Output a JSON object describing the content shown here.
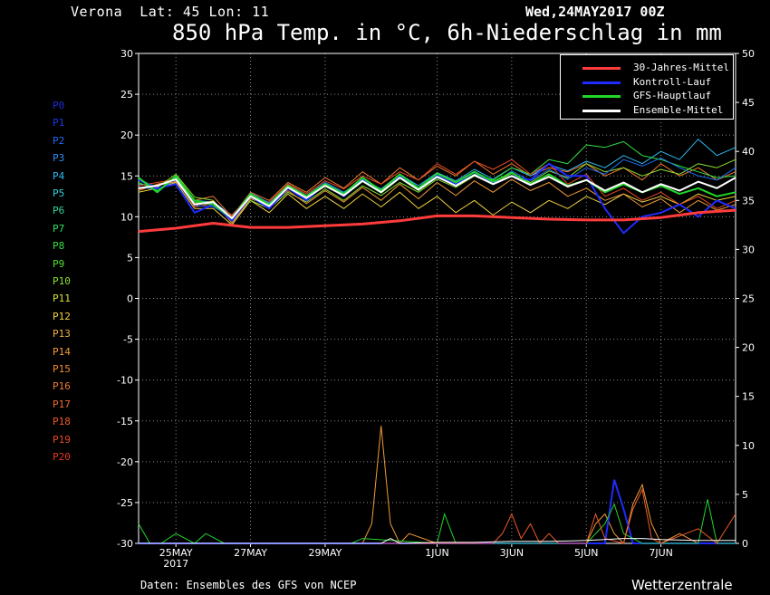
{
  "header": {
    "location": "Verona",
    "coords": "Lat: 45 Lon: 11",
    "run": "Wed,24MAY2017 00Z",
    "title": "850 hPa Temp. in °C, 6h-Niederschlag in mm"
  },
  "footer": {
    "source": "Daten: Ensembles des GFS von NCEP",
    "brand": "Wetterzentrale"
  },
  "members": [
    {
      "label": "P0",
      "color": "#1c2bd6"
    },
    {
      "label": "P1",
      "color": "#1c3ae8"
    },
    {
      "label": "P2",
      "color": "#1f6cf0"
    },
    {
      "label": "P3",
      "color": "#2a90f0"
    },
    {
      "label": "P4",
      "color": "#2fb8f0"
    },
    {
      "label": "P5",
      "color": "#2fd0d8"
    },
    {
      "label": "P6",
      "color": "#2fd8a0"
    },
    {
      "label": "P7",
      "color": "#2fe060"
    },
    {
      "label": "P8",
      "color": "#30e040"
    },
    {
      "label": "P9",
      "color": "#50e030"
    },
    {
      "label": "P10",
      "color": "#8ae030"
    },
    {
      "label": "P11",
      "color": "#d8e030"
    },
    {
      "label": "P12",
      "color": "#f0d040"
    },
    {
      "label": "P13",
      "color": "#f0b040"
    },
    {
      "label": "P14",
      "color": "#f09a38"
    },
    {
      "label": "P15",
      "color": "#f08a30"
    },
    {
      "label": "P16",
      "color": "#f07a30"
    },
    {
      "label": "P17",
      "color": "#f06a30"
    },
    {
      "label": "P18",
      "color": "#f05a2a"
    },
    {
      "label": "P19",
      "color": "#e84a24"
    },
    {
      "label": "P20",
      "color": "#e03a20"
    }
  ],
  "legend": [
    {
      "label": "30-Jahres-Mittel",
      "color": "#ff3b3b"
    },
    {
      "label": "Kontroll-Lauf",
      "color": "#1f2bff"
    },
    {
      "label": "GFS-Hauptlauf",
      "color": "#22d62a"
    },
    {
      "label": "Ensemble-Mittel",
      "color": "#ffffff"
    }
  ],
  "chart_data": {
    "type": "line",
    "x_unit": "days since 24MAY2017 00Z",
    "x_range": [
      0,
      16
    ],
    "x_ticks": [
      {
        "x": 1,
        "label": "25MAY",
        "sublabel": "2017"
      },
      {
        "x": 3,
        "label": "27MAY"
      },
      {
        "x": 5,
        "label": "29MAY"
      },
      {
        "x": 8,
        "label": "1JUN"
      },
      {
        "x": 10,
        "label": "3JUN"
      },
      {
        "x": 12,
        "label": "5JUN"
      },
      {
        "x": 14,
        "label": "7JUN"
      }
    ],
    "y_left": {
      "range": [
        -30,
        30
      ],
      "ticks": [
        -30,
        -25,
        -20,
        -15,
        -10,
        -5,
        0,
        5,
        10,
        15,
        20,
        25,
        30
      ],
      "label": "850 hPa Temp. °C"
    },
    "y_right": {
      "range": [
        0,
        50
      ],
      "ticks": [
        0,
        5,
        10,
        15,
        20,
        25,
        30,
        35,
        40,
        45,
        50
      ],
      "label": "6h-Niederschlag mm"
    },
    "grid": true,
    "series": [
      {
        "name": "30-Jahres-Mittel",
        "axis": "left",
        "width": 3,
        "x": [
          0,
          1,
          2,
          3,
          4,
          5,
          6,
          7,
          8,
          9,
          10,
          11,
          12,
          13,
          14,
          15,
          16
        ],
        "y": [
          8.2,
          8.6,
          9.2,
          8.7,
          8.7,
          8.9,
          9.1,
          9.5,
          10.1,
          10.1,
          9.9,
          9.7,
          9.6,
          9.6,
          9.9,
          10.5,
          10.8
        ]
      },
      {
        "name": "Kontroll-Lauf",
        "axis": "left",
        "width": 2,
        "x": [
          0,
          0.5,
          1,
          1.5,
          2,
          2.5,
          3,
          3.5,
          4,
          4.5,
          5,
          5.5,
          6,
          6.5,
          7,
          7.5,
          8,
          8.5,
          9,
          9.5,
          10,
          10.5,
          11,
          11.5,
          12,
          12.5,
          13,
          13.5,
          14,
          14.5,
          15,
          15.5,
          16
        ],
        "y": [
          14.5,
          13.5,
          14.0,
          10.5,
          11.5,
          9.5,
          12.5,
          11.0,
          13.5,
          12.0,
          14.0,
          12.5,
          14.5,
          13.0,
          15.0,
          13.5,
          15.0,
          14.0,
          15.5,
          14.0,
          15.0,
          14.5,
          16.5,
          15.0,
          15.0,
          11.0,
          8.0,
          10.0,
          10.5,
          11.5,
          10.0,
          12.0,
          11.0
        ]
      },
      {
        "name": "GFS-Hauptlauf",
        "axis": "left",
        "width": 2,
        "x": [
          0,
          0.5,
          1,
          1.5,
          2,
          2.5,
          3,
          3.5,
          4,
          4.5,
          5,
          5.5,
          6,
          6.5,
          7,
          7.5,
          8,
          8.5,
          9,
          9.5,
          10,
          10.5,
          11,
          11.5,
          12,
          12.5,
          13,
          13.5,
          14,
          14.5,
          15,
          15.5,
          16
        ],
        "y": [
          14.8,
          13.0,
          15.0,
          12.0,
          11.5,
          9.8,
          12.8,
          11.5,
          13.8,
          12.5,
          14.0,
          12.8,
          14.8,
          13.2,
          15.2,
          13.5,
          15.3,
          14.2,
          15.5,
          14.3,
          15.4,
          14.0,
          15.2,
          13.8,
          14.5,
          13.0,
          14.0,
          13.0,
          13.8,
          12.8,
          13.5,
          12.5,
          13.0
        ]
      },
      {
        "name": "Ensemble-Mittel",
        "axis": "left",
        "width": 2,
        "x": [
          0,
          0.5,
          1,
          1.5,
          2,
          2.5,
          3,
          3.5,
          4,
          4.5,
          5,
          5.5,
          6,
          6.5,
          7,
          7.5,
          8,
          8.5,
          9,
          9.5,
          10,
          10.5,
          11,
          11.5,
          12,
          12.5,
          13,
          13.5,
          14,
          14.5,
          15,
          15.5,
          16
        ],
        "y": [
          13.5,
          13.8,
          14.6,
          11.5,
          11.8,
          9.8,
          12.5,
          11.3,
          13.6,
          12.3,
          13.8,
          12.6,
          14.4,
          13.0,
          14.8,
          13.3,
          14.9,
          13.8,
          15.1,
          14.0,
          15.0,
          13.9,
          14.9,
          13.7,
          14.5,
          13.2,
          14.2,
          13.0,
          14.0,
          13.2,
          14.3,
          13.5,
          14.8
        ]
      },
      {
        "name": "P16",
        "axis": "left",
        "width": 1,
        "x": [
          0,
          0.5,
          1,
          1.5,
          2,
          2.5,
          3,
          3.5,
          4,
          4.5,
          5,
          5.5,
          6,
          6.5,
          7,
          7.5,
          8,
          8.5,
          9,
          9.5,
          10,
          10.5,
          11,
          11.5,
          12,
          12.5,
          13,
          13.5,
          14,
          14.5,
          15,
          15.5,
          16
        ],
        "y": [
          13.2,
          14.0,
          14.5,
          12.0,
          12.5,
          10.0,
          13.0,
          12.0,
          14.2,
          13.0,
          14.8,
          13.5,
          15.5,
          14.0,
          16.0,
          14.5,
          16.2,
          15.0,
          16.8,
          15.2,
          16.5,
          15.0,
          16.0,
          15.5,
          16.5,
          15.0,
          16.0,
          14.5,
          16.5,
          15.0,
          16.0,
          14.5,
          15.5
        ]
      },
      {
        "name": "P12",
        "axis": "left",
        "width": 1,
        "x": [
          0,
          0.5,
          1,
          1.5,
          2,
          2.5,
          3,
          3.5,
          4,
          4.5,
          5,
          5.5,
          6,
          6.5,
          7,
          7.5,
          8,
          8.5,
          9,
          9.5,
          10,
          10.5,
          11,
          11.5,
          12,
          12.5,
          13,
          13.5,
          14,
          14.5,
          15,
          15.5,
          16
        ],
        "y": [
          13.0,
          13.5,
          14.2,
          11.0,
          11.0,
          9.0,
          12.0,
          10.5,
          12.8,
          11.0,
          12.5,
          11.0,
          12.8,
          11.2,
          13.0,
          11.0,
          12.5,
          10.5,
          12.0,
          10.2,
          11.8,
          10.5,
          12.0,
          11.0,
          12.5,
          11.5,
          12.8,
          11.8,
          12.5,
          11.5,
          12.8,
          12.0,
          12.5
        ]
      },
      {
        "name": "P4",
        "axis": "left",
        "width": 1,
        "x": [
          0,
          0.5,
          1,
          1.5,
          2,
          2.5,
          3,
          3.5,
          4,
          4.5,
          5,
          5.5,
          6,
          6.5,
          7,
          7.5,
          8,
          8.5,
          9,
          9.5,
          10,
          10.5,
          11,
          11.5,
          12,
          12.5,
          13,
          13.5,
          14,
          14.5,
          15,
          15.5,
          16
        ],
        "y": [
          14.0,
          13.8,
          14.8,
          12.0,
          11.8,
          10.2,
          12.6,
          11.6,
          13.9,
          12.6,
          14.2,
          13.0,
          14.6,
          13.4,
          15.2,
          13.8,
          15.4,
          14.4,
          15.8,
          14.6,
          16.0,
          15.0,
          16.4,
          15.6,
          16.8,
          16.0,
          17.5,
          16.5,
          18.0,
          17.0,
          19.5,
          17.5,
          18.5
        ]
      },
      {
        "name": "P8",
        "axis": "left",
        "width": 1,
        "x": [
          0,
          0.5,
          1,
          1.5,
          2,
          2.5,
          3,
          3.5,
          4,
          4.5,
          5,
          5.5,
          6,
          6.5,
          7,
          7.5,
          8,
          8.5,
          9,
          9.5,
          10,
          10.5,
          11,
          11.5,
          12,
          12.5,
          13,
          13.5,
          14,
          14.5,
          15,
          15.5,
          16
        ],
        "y": [
          14.2,
          13.2,
          14.9,
          11.8,
          11.4,
          9.6,
          12.4,
          11.2,
          13.5,
          12.2,
          13.9,
          12.5,
          14.3,
          12.9,
          14.7,
          13.2,
          14.8,
          13.9,
          15.2,
          14.5,
          16.0,
          15.2,
          17.0,
          16.5,
          18.8,
          18.5,
          19.2,
          17.5,
          17.0,
          16.2,
          15.5,
          14.8,
          15.0
        ]
      },
      {
        "name": "P19",
        "axis": "left",
        "width": 1,
        "x": [
          0,
          0.5,
          1,
          1.5,
          2,
          2.5,
          3,
          3.5,
          4,
          4.5,
          5,
          5.5,
          6,
          6.5,
          7,
          7.5,
          8,
          8.5,
          9,
          9.5,
          10,
          10.5,
          11,
          11.5,
          12,
          12.5,
          13,
          13.5,
          14,
          14.5,
          15,
          15.5,
          16
        ],
        "y": [
          13.8,
          14.2,
          14.6,
          11.2,
          11.6,
          10.2,
          12.6,
          11.8,
          14.0,
          12.8,
          14.4,
          13.4,
          15.0,
          14.0,
          15.5,
          14.5,
          16.5,
          15.2,
          16.8,
          15.8,
          17.0,
          15.2,
          16.5,
          14.0,
          15.2,
          12.5,
          13.5,
          12.0,
          13.0,
          11.5,
          12.5,
          11.0,
          12.0
        ]
      },
      {
        "name": "P10",
        "axis": "left",
        "width": 1,
        "x": [
          0,
          0.5,
          1,
          1.5,
          2,
          2.5,
          3,
          3.5,
          4,
          4.5,
          5,
          5.5,
          6,
          6.5,
          7,
          7.5,
          8,
          8.5,
          9,
          9.5,
          10,
          10.5,
          11,
          11.5,
          12,
          12.5,
          13,
          13.5,
          14,
          14.5,
          15,
          15.5,
          16
        ],
        "y": [
          14.6,
          13.6,
          15.2,
          12.4,
          12.0,
          9.4,
          12.0,
          11.0,
          13.0,
          11.8,
          13.4,
          12.0,
          13.8,
          12.6,
          14.2,
          13.0,
          14.6,
          13.6,
          15.0,
          14.0,
          15.3,
          14.2,
          15.6,
          14.8,
          16.5,
          15.5,
          16.0,
          15.0,
          15.8,
          15.2,
          16.5,
          16.0,
          17.0
        ]
      },
      {
        "name": "P2",
        "axis": "left",
        "width": 1,
        "x": [
          0,
          0.5,
          1,
          1.5,
          2,
          2.5,
          3,
          3.5,
          4,
          4.5,
          5,
          5.5,
          6,
          6.5,
          7,
          7.5,
          8,
          8.5,
          9,
          9.5,
          10,
          10.5,
          11,
          11.5,
          12,
          12.5,
          13,
          13.5,
          14,
          14.5,
          15,
          15.5,
          16
        ],
        "y": [
          13.6,
          13.4,
          14.4,
          11.4,
          11.2,
          9.9,
          12.9,
          11.7,
          13.8,
          12.4,
          14.2,
          12.9,
          14.6,
          13.1,
          15.0,
          13.4,
          15.1,
          14.0,
          15.4,
          14.1,
          15.6,
          14.4,
          15.8,
          14.6,
          16.0,
          15.2,
          17.0,
          16.2,
          17.2,
          16.0,
          15.0,
          14.5,
          16.0
        ]
      },
      {
        "name": "P14",
        "axis": "left",
        "width": 1,
        "x": [
          0,
          0.5,
          1,
          1.5,
          2,
          2.5,
          3,
          3.5,
          4,
          4.5,
          5,
          5.5,
          6,
          6.5,
          7,
          7.5,
          8,
          8.5,
          9,
          9.5,
          10,
          10.5,
          11,
          11.5,
          12,
          12.5,
          13,
          13.5,
          14,
          14.5,
          15,
          15.5,
          16
        ],
        "y": [
          13.4,
          13.9,
          14.3,
          11.6,
          11.9,
          9.2,
          12.2,
          11.4,
          13.2,
          11.6,
          13.2,
          11.8,
          13.6,
          12.0,
          14.0,
          12.2,
          14.2,
          12.6,
          14.4,
          13.0,
          14.6,
          13.2,
          14.2,
          12.5,
          13.5,
          12.0,
          12.8,
          11.2,
          12.2,
          10.5,
          12.0,
          10.8,
          11.5
        ]
      }
    ],
    "precip_series": [
      {
        "name": "P14",
        "axis": "right",
        "x": [
          0,
          6,
          6.25,
          6.5,
          6.75,
          7,
          7.25,
          8,
          12,
          12.25,
          12.5,
          12.75,
          13,
          13.25,
          13.5,
          13.75,
          14,
          14.5,
          15,
          16
        ],
        "y": [
          0,
          0,
          2,
          12,
          2,
          0,
          1,
          0,
          0,
          2,
          3,
          1,
          0,
          4,
          6,
          2,
          0,
          1,
          0,
          0
        ]
      },
      {
        "name": "Kontroll-Lauf",
        "axis": "right",
        "x": [
          0,
          12.5,
          12.75,
          13,
          13.25,
          13.5,
          16
        ],
        "y": [
          0,
          0,
          6.5,
          3.5,
          0,
          0,
          0
        ]
      },
      {
        "name": "GFS-Hauptlauf",
        "axis": "right",
        "x": [
          0,
          0.3,
          0.6,
          1,
          1.5,
          1.8,
          2.3,
          5.7,
          6,
          8,
          8.2,
          8.5,
          11,
          12,
          12.5,
          12.75,
          13,
          13.5,
          15,
          15.25,
          15.5,
          16
        ],
        "y": [
          2,
          0,
          0,
          1,
          0,
          1,
          0,
          0,
          0.5,
          0,
          3,
          0,
          0,
          0,
          2,
          4,
          1,
          0,
          0,
          4.5,
          0,
          0
        ]
      },
      {
        "name": "P18",
        "axis": "right",
        "x": [
          0,
          9.5,
          9.75,
          10,
          10.25,
          10.5,
          10.75,
          11,
          11.25,
          11.5,
          12,
          12.25,
          12.5,
          13,
          13.25,
          13.5,
          13.75,
          14,
          15,
          15.5,
          16
        ],
        "y": [
          0,
          0,
          1,
          3,
          0.5,
          2,
          0,
          1,
          0,
          0,
          0,
          3,
          0.5,
          0,
          3.5,
          5.5,
          0.5,
          0,
          1.5,
          0,
          3
        ]
      },
      {
        "name": "Ensemble-Mittel",
        "axis": "right",
        "x": [
          0,
          6.5,
          6.75,
          7,
          8,
          9,
          10,
          11,
          12,
          12.5,
          13,
          13.5,
          14,
          15,
          16
        ],
        "y": [
          0,
          0,
          0.5,
          0,
          0.1,
          0.1,
          0.2,
          0.2,
          0.3,
          0.4,
          0.5,
          0.5,
          0.4,
          0.3,
          0.3
        ]
      }
    ]
  }
}
